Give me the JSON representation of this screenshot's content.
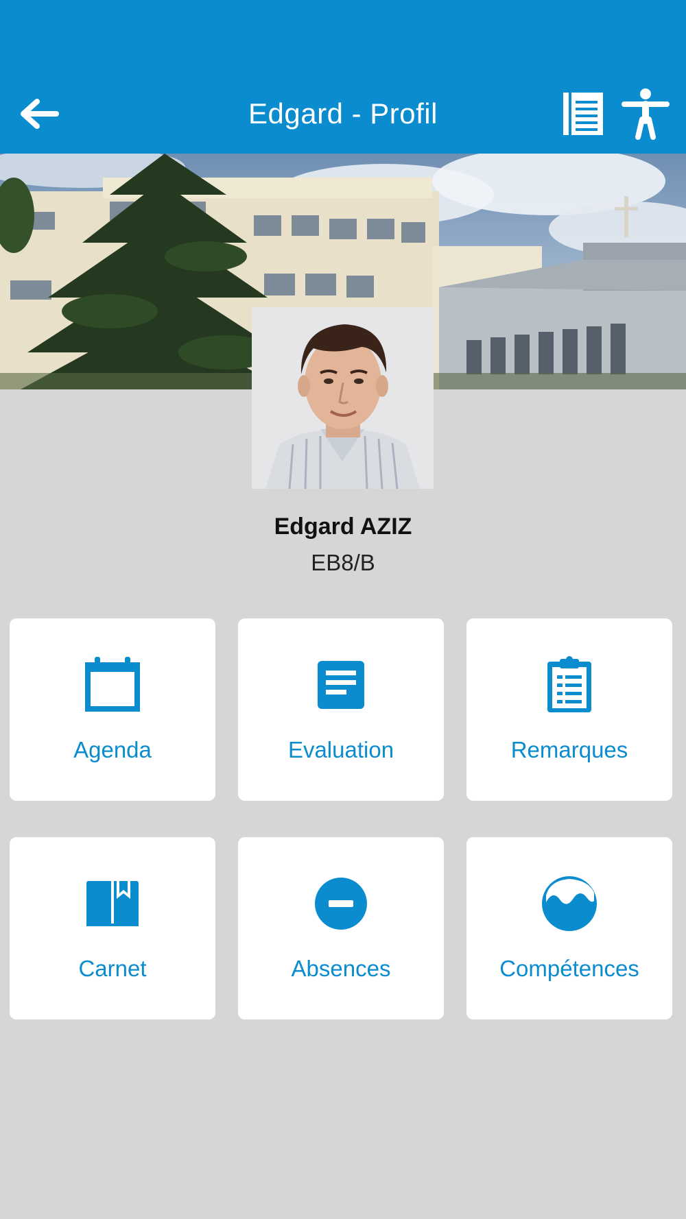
{
  "header": {
    "title": "Edgard - Profil",
    "back_icon": "arrow-left-icon",
    "notes_icon": "document-list-icon",
    "accessibility_icon": "accessibility-person-icon",
    "color": "#0a8ccf"
  },
  "banner": {
    "image": "school-building-photo"
  },
  "student": {
    "name": "Edgard AZIZ",
    "class": "EB8/B",
    "photo": "student-portrait-photo"
  },
  "menu": {
    "accent": "#0a8ccf",
    "items": [
      {
        "label": "Agenda",
        "icon": "calendar-icon"
      },
      {
        "label": "Evaluation",
        "icon": "document-icon"
      },
      {
        "label": "Remarques",
        "icon": "clipboard-icon"
      },
      {
        "label": "Carnet",
        "icon": "book-icon"
      },
      {
        "label": "Absences",
        "icon": "minus-circle-icon"
      },
      {
        "label": "Compétences",
        "icon": "wave-circle-icon"
      }
    ]
  }
}
